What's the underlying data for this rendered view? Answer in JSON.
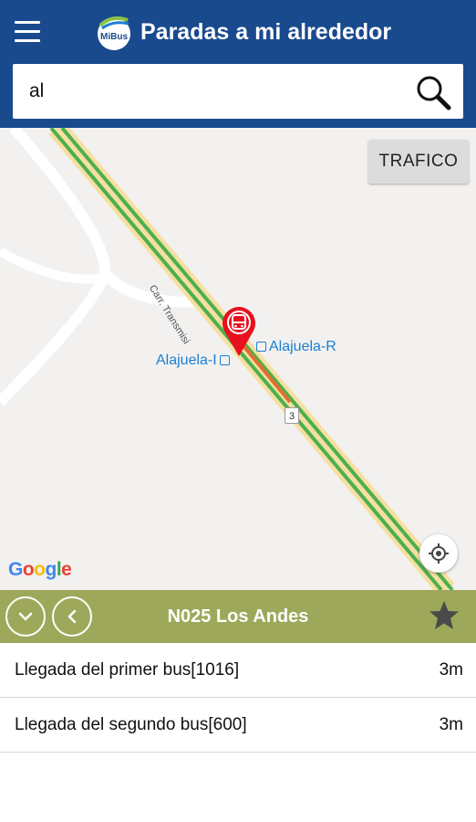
{
  "app": {
    "title": "Paradas a mi alrededor",
    "logo_text": "MiBus",
    "menu_icon": "hamburger-menu-icon"
  },
  "search": {
    "value": "al",
    "icon": "search-icon"
  },
  "map": {
    "traffic_button": "TRAFICO",
    "road_name": "Carr. Transmisi",
    "route_number": "3",
    "stops": [
      {
        "label": "Alajuela-R"
      },
      {
        "label": "Alajuela-I"
      }
    ],
    "attribution": "Google",
    "locate_icon": "my-location-icon",
    "marker_icon": "bus-stop-marker-icon"
  },
  "route_bar": {
    "title": "N025 Los Andes",
    "collapse_icon": "chevron-down-icon",
    "back_icon": "chevron-left-icon",
    "favorite_icon": "star-icon"
  },
  "arrivals": [
    {
      "label": "Llegada del primer bus[1016]",
      "time": "3m"
    },
    {
      "label": "Llegada del segundo bus[600]",
      "time": "3m"
    }
  ],
  "colors": {
    "appbar": "#1a4a8e",
    "route_bar": "#9ea85a",
    "marker": "#e8101e",
    "stop_label": "#1b7fd4",
    "traffic_green": "#4caf50"
  }
}
